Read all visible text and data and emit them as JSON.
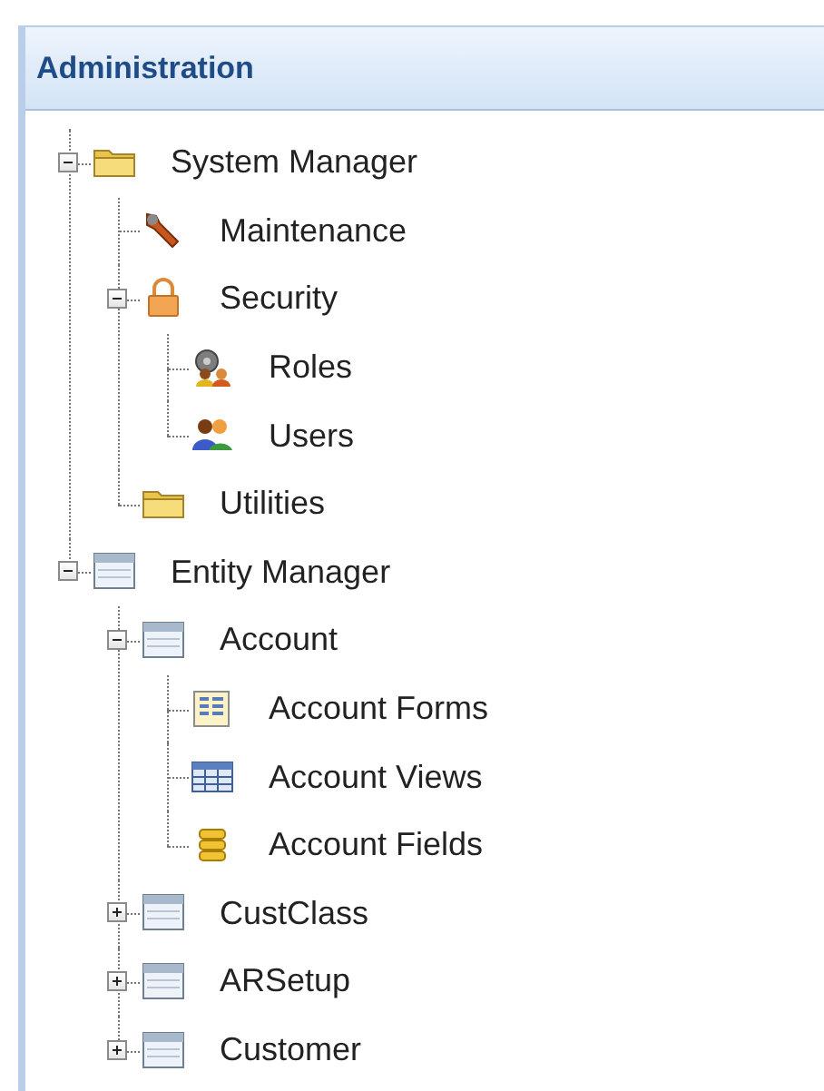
{
  "panel": {
    "title": "Administration"
  },
  "tree": {
    "items": [
      {
        "label": "System Manager",
        "kind": "folder",
        "expanded": true,
        "children": [
          {
            "label": "Maintenance",
            "kind": "wrench"
          },
          {
            "label": "Security",
            "kind": "lock",
            "expanded": true,
            "children": [
              {
                "label": "Roles",
                "kind": "roles"
              },
              {
                "label": "Users",
                "kind": "users"
              }
            ]
          },
          {
            "label": "Utilities",
            "kind": "folder"
          }
        ]
      },
      {
        "label": "Entity Manager",
        "kind": "table",
        "expanded": true,
        "children": [
          {
            "label": "Account",
            "kind": "table",
            "expanded": true,
            "children": [
              {
                "label": "Account Forms",
                "kind": "form"
              },
              {
                "label": "Account Views",
                "kind": "grid"
              },
              {
                "label": "Account Fields",
                "kind": "database"
              }
            ]
          },
          {
            "label": "CustClass",
            "kind": "table",
            "expanded": false
          },
          {
            "label": "ARSetup",
            "kind": "table",
            "expanded": false
          },
          {
            "label": "Customer",
            "kind": "table",
            "expanded": false
          }
        ]
      }
    ]
  }
}
